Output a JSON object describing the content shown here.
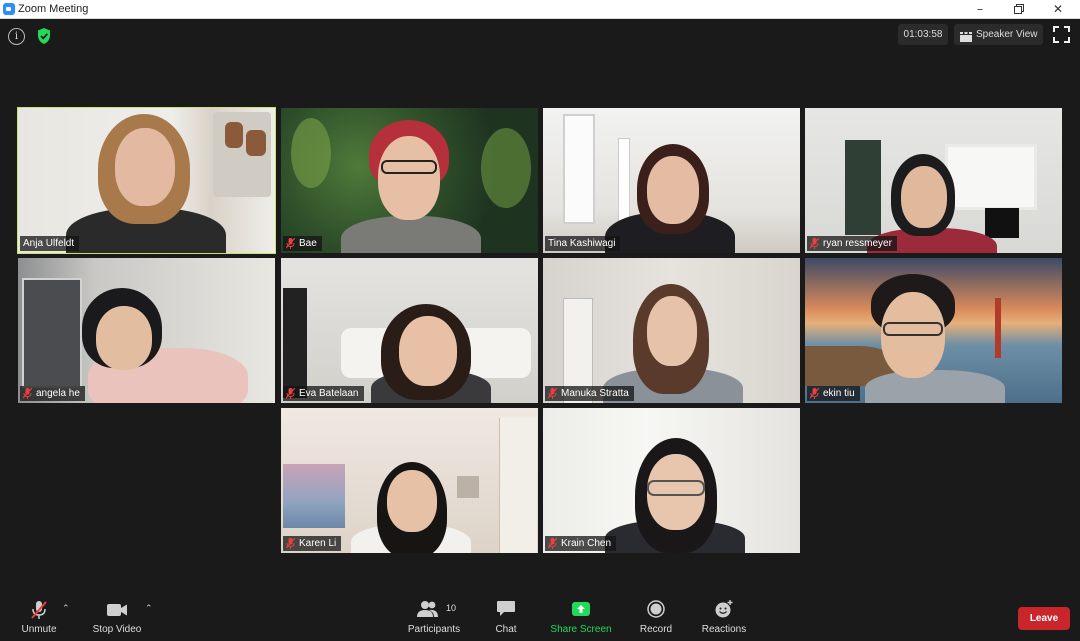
{
  "window": {
    "title": "Zoom Meeting",
    "controls": [
      "minimize-icon",
      "restore-icon",
      "close-icon"
    ]
  },
  "topbar": {
    "timer": "01:03:58",
    "speaker_view_label": "Speaker View",
    "icons": [
      "info-icon",
      "shield-check-icon",
      "fullscreen-icon"
    ]
  },
  "colors": {
    "active_speaker_border": "#c6e36b",
    "leave_button": "#c9262c",
    "share_screen": "#23d959",
    "background": "#1a1a1a"
  },
  "participants": [
    {
      "name": "Anja Ulfeldt",
      "muted": false,
      "active": true
    },
    {
      "name": "Bae",
      "muted": true,
      "active": false
    },
    {
      "name": "Tina Kashiwagi",
      "muted": false,
      "active": false
    },
    {
      "name": "ryan ressmeyer",
      "muted": true,
      "active": false
    },
    {
      "name": "angela he",
      "muted": true,
      "active": false
    },
    {
      "name": "Eva Batelaan",
      "muted": true,
      "active": false
    },
    {
      "name": "Manuka Stratta",
      "muted": true,
      "active": false
    },
    {
      "name": "ekin tiu",
      "muted": true,
      "active": false
    },
    {
      "name": "Karen Li",
      "muted": true,
      "active": false
    },
    {
      "name": "Krain Chen",
      "muted": true,
      "active": false
    }
  ],
  "toolbar": {
    "unmute_label": "Unmute",
    "stop_video_label": "Stop Video",
    "participants_label": "Participants",
    "participants_count": "10",
    "chat_label": "Chat",
    "share_screen_label": "Share Screen",
    "record_label": "Record",
    "reactions_label": "Reactions",
    "leave_label": "Leave"
  }
}
